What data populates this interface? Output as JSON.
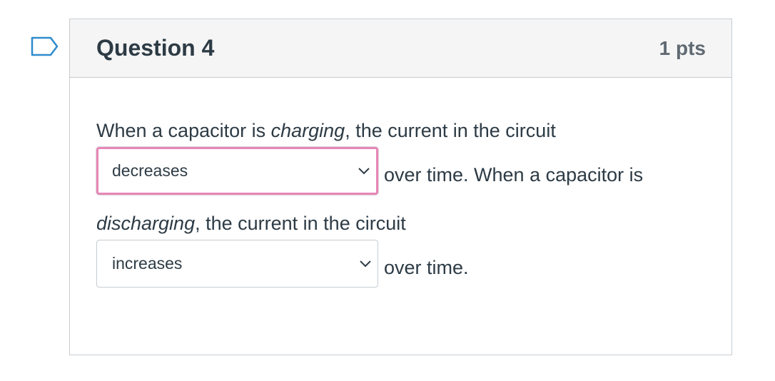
{
  "question": {
    "title": "Question 4",
    "points": "1 pts"
  },
  "body": {
    "line1_pre": "When a capacitor is ",
    "line1_italic": "charging",
    "line1_post": ", the current in the circuit",
    "select1_value": "decreases",
    "after1": "over time. When a capacitor is",
    "line2_italic": "discharging",
    "line2_post": ", the current in the circuit",
    "select2_value": "increases",
    "after2": "over time."
  },
  "colors": {
    "highlight_border": "#e887b7",
    "header_bg": "#f5f5f5",
    "text": "#2d3b45",
    "points_text": "#606a73"
  },
  "icons": {
    "flag": "bookmark-flag-icon",
    "dropdown": "chevron-down-icon"
  }
}
